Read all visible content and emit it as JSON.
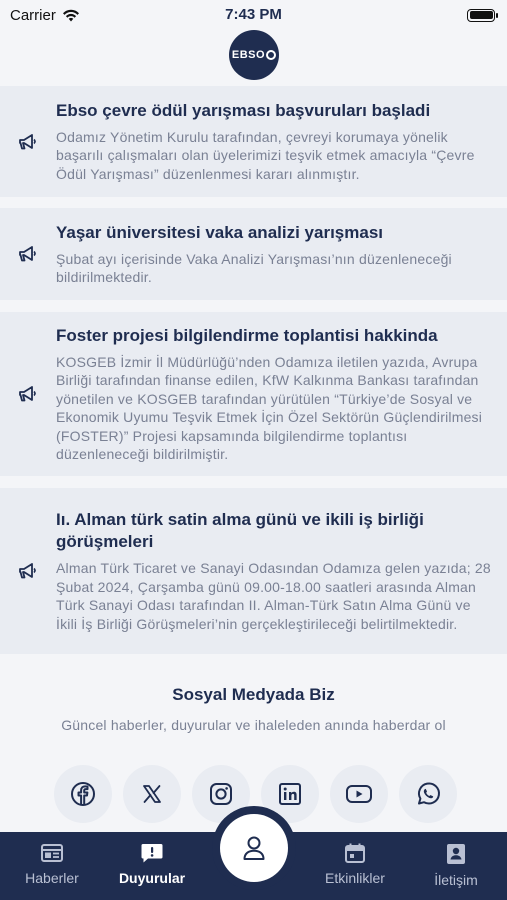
{
  "status": {
    "carrier": "Carrier",
    "time": "7:43 PM"
  },
  "logo": {
    "text": "EBSO"
  },
  "announcements": [
    {
      "title": "Ebso çevre ödül yarışması başvuruları başladi",
      "text": "Odamız Yönetim Kurulu tarafından, çevreyi korumaya yönelik başarılı çalışmaları olan üyelerimizi teşvik etmek amacıyla “Çevre Ödül Yarışması” düzenlenmesi kararı alınmıştır."
    },
    {
      "title": "Yaşar üniversitesi vaka analizi yarışması",
      "text": "Şubat ayı içerisinde Vaka Analizi Yarışması’nın düzenleneceği bildirilmektedir."
    },
    {
      "title": "Foster projesi bilgilendirme toplantisi hakkinda",
      "text": "KOSGEB İzmir İl Müdürlüğü’nden Odamıza iletilen yazıda, Avrupa Birliği tarafından finanse edilen, KfW Kalkınma Bankası tarafından yönetilen ve KOSGEB tarafından yürütülen “Türkiye’de Sosyal ve Ekonomik Uyumu Teşvik Etmek İçin Özel Sektörün Güçlendirilmesi (FOSTER)” Projesi kapsamında bilgilendirme toplantısı düzenleneceği bildirilmiştir."
    },
    {
      "title": "Iı. Alman türk satin alma günü ve ikili iş birliği görüşmeleri",
      "text": "Alman Türk Ticaret ve Sanayi Odasından Odamıza gelen yazıda; 28 Şubat 2024, Çarşamba günü 09.00-18.00 saatleri arasında Alman Türk Sanayi Odası tarafından II. Alman-Türk Satın Alma Günü ve İkili İş Birliği Görüşmeleri’nin gerçekleştirileceği belirtilmektedir."
    }
  ],
  "social": {
    "title": "Sosyal Medyada Biz",
    "subtitle": "Güncel haberler, duyurular ve ihaleleden anında haberdar ol",
    "icons": [
      "facebook-icon",
      "x-icon",
      "instagram-icon",
      "linkedin-icon",
      "youtube-icon",
      "whatsapp-icon"
    ]
  },
  "tabs": {
    "haberler": "Haberler",
    "duyurular": "Duyurular",
    "etkinlikler": "Etkinlikler",
    "iletisim": "İletişim"
  },
  "colors": {
    "primary": "#1f2d50",
    "card": "#e9ecf2",
    "muted": "#7a8194"
  }
}
